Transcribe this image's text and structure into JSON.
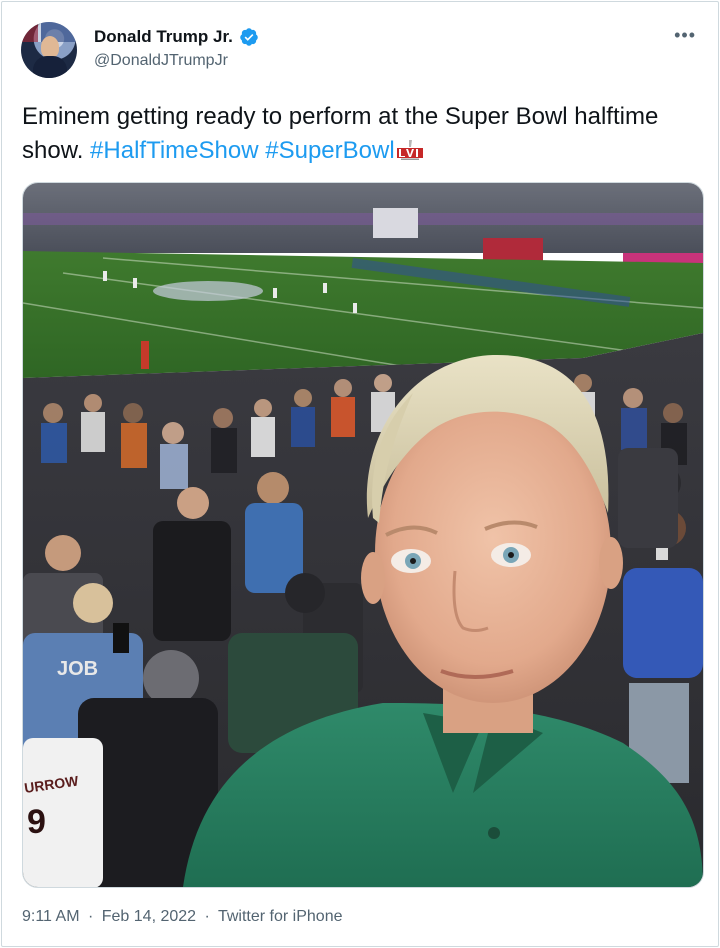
{
  "author": {
    "display_name": "Donald Trump Jr.",
    "handle": "@DonaldJTrumpJr",
    "verified": true,
    "avatar_icon": "avatar-photo"
  },
  "tweet": {
    "text_main": "Eminem getting ready to perform at the Super Bowl halftime show.",
    "hashtags": [
      "#HalfTimeShow",
      "#SuperBowl"
    ],
    "emoji_icon": "super-bowl-lvi-logo"
  },
  "media": {
    "jersey_text_left": "JOB",
    "jersey_text_bottom": "URROW",
    "jersey_number": "9"
  },
  "meta": {
    "time": "9:11 AM",
    "separator": "·",
    "date": "Feb 14, 2022",
    "source": "Twitter for iPhone"
  },
  "colors": {
    "link": "#1d9bf0",
    "verified": "#1d9bf0",
    "secondary_text": "#536471"
  }
}
